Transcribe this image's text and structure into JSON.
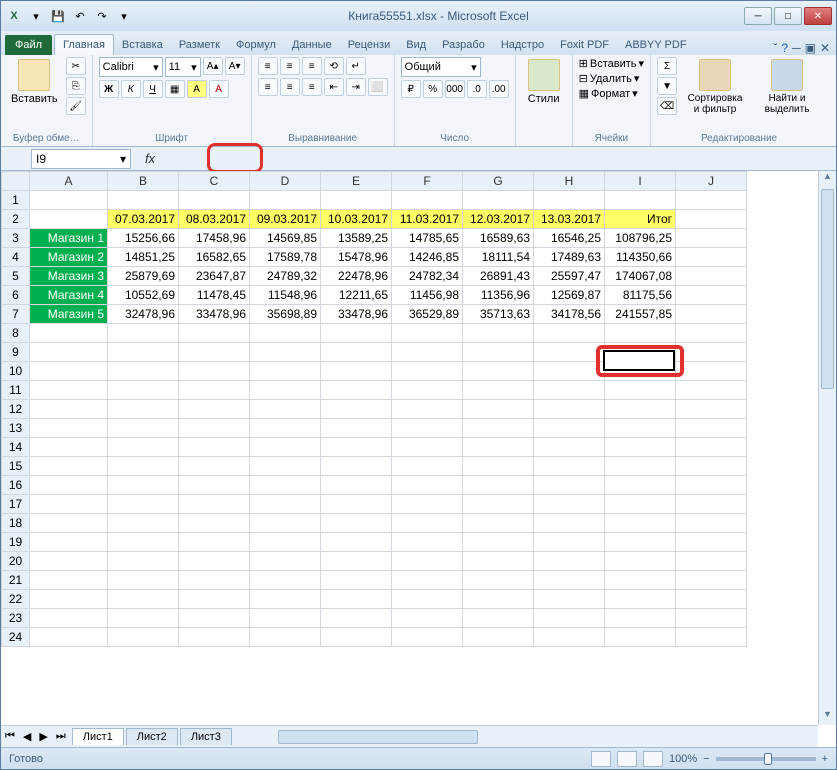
{
  "window": {
    "title": "Книга55551.xlsx - Microsoft Excel"
  },
  "qat": {
    "excel": "X",
    "save": "💾",
    "undo": "↶",
    "redo": "↷",
    "dd": "▾"
  },
  "winbtns": {
    "min": "─",
    "max": "□",
    "close": "✕"
  },
  "tabs": {
    "file": "Файл",
    "items": [
      "Главная",
      "Вставка",
      "Разметк",
      "Формул",
      "Данные",
      "Рецензи",
      "Вид",
      "Разрабо",
      "Надстро",
      "Foxit PDF",
      "ABBYY PDF"
    ],
    "active": 0
  },
  "help": {
    "q": "?",
    "min": "ˇ",
    "wmin": "─",
    "wmax": "▣",
    "wclose": "✕"
  },
  "ribbon": {
    "clipboard": {
      "paste": "Вставить",
      "label": "Буфер обме…"
    },
    "font": {
      "name": "Calibri",
      "size": "11",
      "bold": "Ж",
      "italic": "К",
      "underline": "Ч",
      "label": "Шрифт"
    },
    "align": {
      "label": "Выравнивание"
    },
    "number": {
      "format": "Общий",
      "label": "Число"
    },
    "styles": {
      "btn": "Стили",
      "label": ""
    },
    "cells": {
      "insert": "Вставить",
      "delete": "Удалить",
      "format": "Формат",
      "label": "Ячейки"
    },
    "editing": {
      "sort": "Сортировка и фильтр",
      "find": "Найти и выделить",
      "label": "Редактирование"
    }
  },
  "formulabar": {
    "name": "I9",
    "fx": "fx",
    "value": ""
  },
  "columns": [
    "A",
    "B",
    "C",
    "D",
    "E",
    "F",
    "G",
    "H",
    "I",
    "J"
  ],
  "headerRow": [
    "",
    "07.03.2017",
    "08.03.2017",
    "09.03.2017",
    "10.03.2017",
    "11.03.2017",
    "12.03.2017",
    "13.03.2017",
    "Итог"
  ],
  "shops": [
    {
      "name": "Магазин 1",
      "vals": [
        "15256,66",
        "17458,96",
        "14569,85",
        "13589,25",
        "14785,65",
        "16589,63",
        "16546,25",
        "108796,25"
      ]
    },
    {
      "name": "Магазин 2",
      "vals": [
        "14851,25",
        "16582,65",
        "17589,78",
        "15478,96",
        "14246,85",
        "18111,54",
        "17489,63",
        "114350,66"
      ]
    },
    {
      "name": "Магазин 3",
      "vals": [
        "25879,69",
        "23647,87",
        "24789,32",
        "22478,96",
        "24782,34",
        "26891,43",
        "25597,47",
        "174067,08"
      ]
    },
    {
      "name": "Магазин 4",
      "vals": [
        "10552,69",
        "11478,45",
        "11548,96",
        "12211,65",
        "11456,98",
        "11356,96",
        "12569,87",
        "81175,56"
      ]
    },
    {
      "name": "Магазин 5",
      "vals": [
        "32478,96",
        "33478,96",
        "35698,89",
        "33478,96",
        "36529,89",
        "35713,63",
        "34178,56",
        "241557,85"
      ]
    }
  ],
  "blankRows": [
    1,
    8,
    9,
    10,
    11,
    12,
    13,
    14,
    15,
    16,
    17,
    18,
    19,
    20,
    21,
    22,
    23,
    24
  ],
  "sheets": {
    "tabs": [
      "Лист1",
      "Лист2",
      "Лист3"
    ],
    "active": 0,
    "nav": [
      "⏮",
      "◀",
      "▶",
      "⏭"
    ]
  },
  "status": {
    "ready": "Готово",
    "zoom": "100%",
    "minus": "−",
    "plus": "+"
  },
  "selection": {
    "cell": "I9"
  }
}
